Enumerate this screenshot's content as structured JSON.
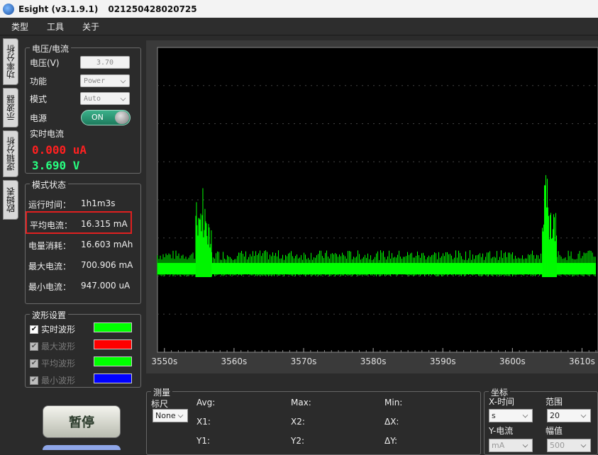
{
  "window": {
    "app_name": "Esight (v3.1.9.1)",
    "device_id": "021250428020725"
  },
  "menu": [
    "类型",
    "工具",
    "关于"
  ],
  "side_tabs": [
    "功率分析",
    "示波器",
    "逻辑分析",
    "欧姆表"
  ],
  "power_panel": {
    "title": "电压/电流",
    "voltage_label": "电压(V)",
    "voltage_value": "3.70",
    "function_label": "功能",
    "function_value": "Power",
    "mode_label": "模式",
    "mode_value": "Auto",
    "power_label": "电源",
    "power_toggle": "ON",
    "live_current_label": "实时电流",
    "live_current": "0.000 uA",
    "live_voltage": "3.690 V"
  },
  "mode_status": {
    "title": "模式状态",
    "rows": [
      {
        "label": "运行时间：",
        "value": "1h1m3s"
      },
      {
        "label": "平均电流：",
        "value": "16.315 mA"
      },
      {
        "label": "电量消耗：",
        "value": "16.603 mAh"
      },
      {
        "label": "最大电流：",
        "value": "700.906 mA"
      },
      {
        "label": "最小电流：",
        "value": "947.000 uA"
      }
    ]
  },
  "waveform_settings": {
    "title": "波形设置",
    "items": [
      {
        "label": "实时波形",
        "checked": true,
        "enabled": true,
        "color": "#00ff00"
      },
      {
        "label": "最大波形",
        "checked": true,
        "enabled": false,
        "color": "#ff0000"
      },
      {
        "label": "平均波形",
        "checked": true,
        "enabled": false,
        "color": "#00ff00"
      },
      {
        "label": "最小波形",
        "checked": true,
        "enabled": false,
        "color": "#0000ff"
      }
    ]
  },
  "pause_button": "暂停",
  "chart_data": {
    "type": "line",
    "x_ticks": [
      "3550s",
      "3560s",
      "3570s",
      "3580s",
      "3590s",
      "3600s",
      "3610s"
    ],
    "series": [
      {
        "color": "#00ff00",
        "segments": [
          {
            "x_range": [
              3549,
              3554.5
            ],
            "level": "baseline"
          },
          {
            "x_range": [
              3554.5,
              3556.8
            ],
            "level": "burst"
          },
          {
            "x_range": [
              3556.8,
              3604.3
            ],
            "level": "baseline"
          },
          {
            "x_range": [
              3604.3,
              3606.4
            ],
            "level": "burst"
          },
          {
            "x_range": [
              3606.4,
              3612
            ],
            "level": "baseline"
          }
        ]
      }
    ],
    "grid": true,
    "background": "#000000"
  },
  "measure": {
    "title": "测量",
    "ruler_label": "标尺",
    "ruler_value": "None",
    "avg_label": "Avg:",
    "max_label": "Max:",
    "min_label": "Min:",
    "x1_label": "X1:",
    "x2_label": "X2:",
    "dx_label": "ΔX:",
    "y1_label": "Y1:",
    "y2_label": "Y2:",
    "dy_label": "ΔY:"
  },
  "coords": {
    "title": "坐标",
    "x_label": "X-时间",
    "x_unit": "s",
    "range_label": "范围",
    "range_value": "20",
    "y_label": "Y-电流",
    "y_unit": "mA",
    "amp_label": "幅值",
    "amp_value": "500"
  }
}
